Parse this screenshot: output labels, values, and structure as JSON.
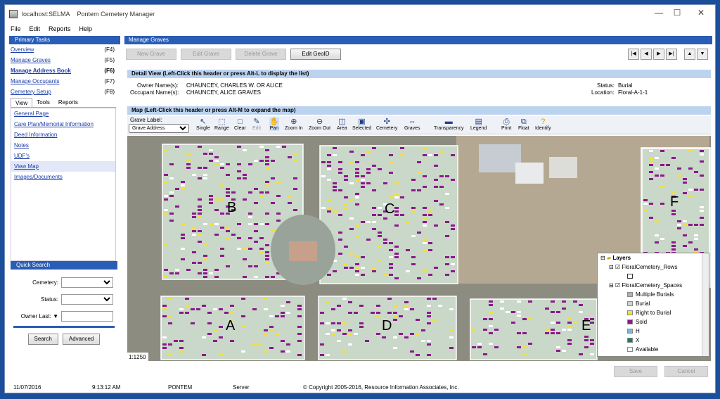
{
  "titlebar": {
    "host": "localhost:SELMA",
    "app": "Pontem Cemetery Manager",
    "min": "—",
    "max": "☐",
    "close": "✕"
  },
  "menu": [
    "File",
    "Edit",
    "Reports",
    "Help"
  ],
  "primary_tasks": {
    "title": "Primary Tasks",
    "items": [
      {
        "label": "Overview",
        "key": "(F4)"
      },
      {
        "label": "Manage Graves",
        "key": "(F5)"
      },
      {
        "label": "Manage Address Book",
        "key": "(F6)"
      },
      {
        "label": "Manage Occupants",
        "key": "(F7)"
      },
      {
        "label": "Cemetery Setup",
        "key": "(F8)"
      }
    ]
  },
  "view_tabs": [
    "View",
    "Tools",
    "Reports"
  ],
  "view_items": [
    "General Page",
    "Care Plan/Memorial Information",
    "Deed Information",
    "Notes",
    "UDF's",
    "View Map",
    "Images/Documents"
  ],
  "quick_search": {
    "title": "Quick Search",
    "cemetery_label": "Cemetery:",
    "status_label": "Status:",
    "owner_label": "Owner Last:",
    "owner_arrow": "▼",
    "search_btn": "Search",
    "advanced_btn": "Advanced"
  },
  "main": {
    "title": "Manage Graves",
    "buttons": {
      "new": "New Grave",
      "edit": "Edit Grave",
      "delete": "Delete Grave",
      "geoid": "Edit GeoID"
    },
    "nav": [
      "|◀",
      "◀",
      "▶",
      "▶|",
      "▲",
      "▼"
    ],
    "detail_header": "Detail View (Left-Click this header or press Alt-L to display the list)",
    "owner_label": "Owner Name(s):",
    "owner_value": "CHAUNCEY, CHARLES W. OR ALICE",
    "occupant_label": "Occupant Name(s):",
    "occupant_value": "CHAUNCEY, ALICE GRAVES",
    "status_label": "Status:",
    "status_value": "Burial",
    "location_label": "Location:",
    "location_value": "Floral-A-1-1",
    "map_header": "Map (Left-Click this header or press Alt-M to expand the map)",
    "grave_label": "Grave Label:",
    "grave_select": "Grave Address",
    "tools": [
      "Single",
      "Range",
      "Clear",
      "Edit",
      "Pan",
      "Zoom In",
      "Zoom Out",
      "Area",
      "Selected",
      "Cemetery",
      "Graves",
      "Transparency",
      "Legend",
      "Print",
      "Float",
      "Identify"
    ],
    "sections": [
      "B",
      "C",
      "A",
      "D",
      "E",
      "F"
    ],
    "scale": "1:1250",
    "save_btn": "Save",
    "cancel_btn": "Cancel"
  },
  "layers": {
    "title": "Layers",
    "rows_layer": "FloralCemetery_Rows",
    "spaces_layer": "FloralCemetery_Spaces",
    "items": [
      {
        "label": "Multiple Burials",
        "color": "#b0b0b0"
      },
      {
        "label": "Burial",
        "color": "#c8d8c8"
      },
      {
        "label": "Right to Burial",
        "color": "#f0e040"
      },
      {
        "label": "Sold",
        "color": "#8a1a8a"
      },
      {
        "label": "H",
        "color": "#7ab8e0"
      },
      {
        "label": "X",
        "color": "#1a7a6a"
      },
      {
        "label": "Available",
        "color": "#ffffff"
      }
    ]
  },
  "status": {
    "date": "11/07/2016",
    "time": "9:13:12 AM",
    "user": "PONTEM",
    "server": "Server",
    "copyright": "© Copyright 2005-2016, Resource Information Associates, Inc."
  }
}
